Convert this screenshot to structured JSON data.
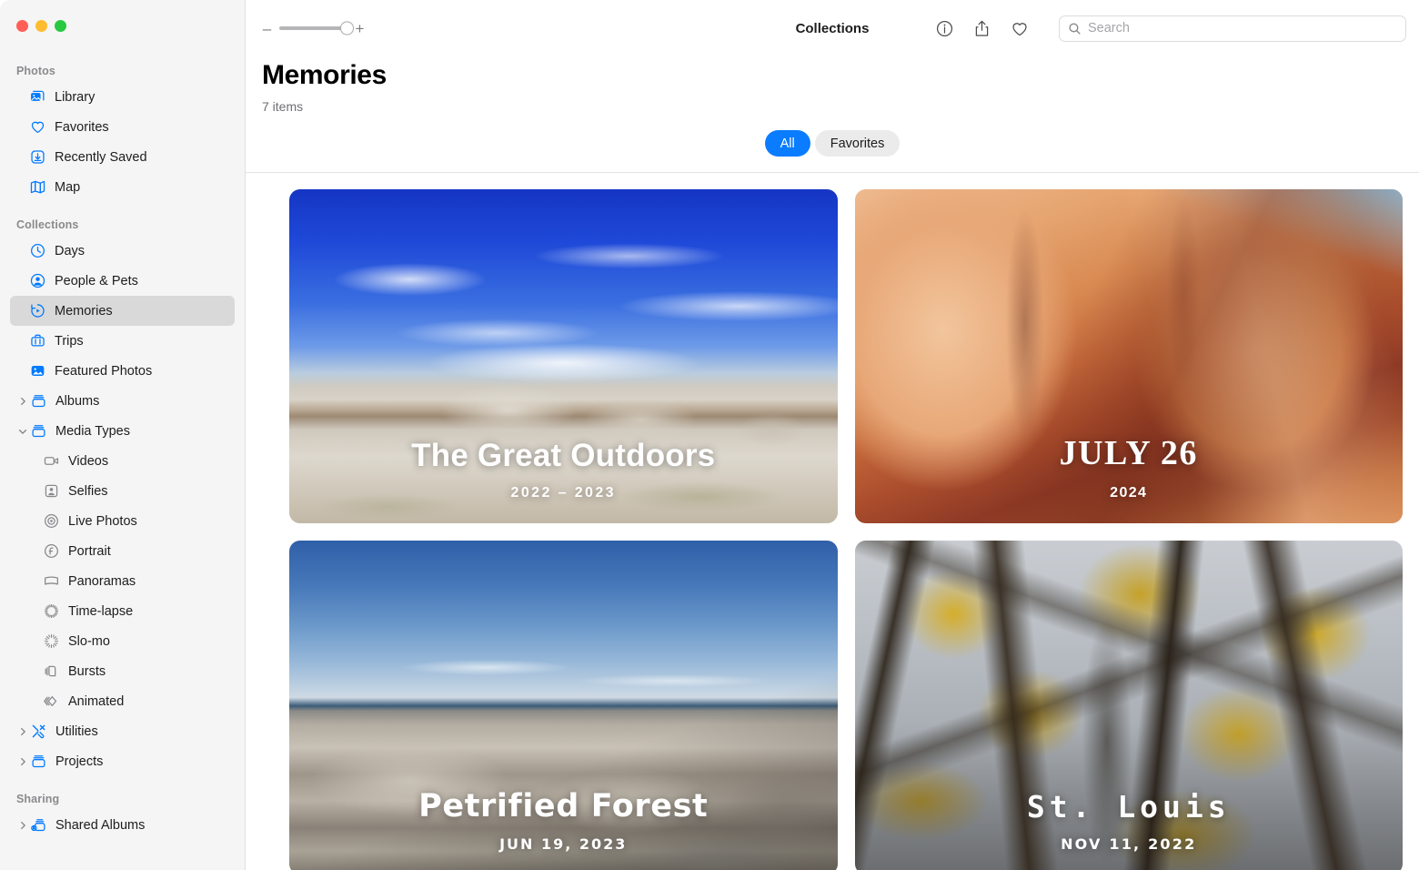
{
  "window": {
    "traffic_lights": [
      {
        "name": "close",
        "color": "#ff5f57"
      },
      {
        "name": "minimize",
        "color": "#febc2e"
      },
      {
        "name": "zoom",
        "color": "#28c840"
      }
    ]
  },
  "toolbar": {
    "zoom_out_label": "–",
    "zoom_in_label": "+",
    "zoom_value": 85,
    "title": "Collections",
    "icons": [
      {
        "name": "info-icon",
        "label": "Info"
      },
      {
        "name": "share-icon",
        "label": "Share"
      },
      {
        "name": "favorite-heart-icon",
        "label": "Favorite"
      }
    ],
    "search": {
      "placeholder": "Search",
      "value": "",
      "icon": "search-icon"
    }
  },
  "sidebar": {
    "sections": [
      {
        "title": "Photos",
        "items": [
          {
            "label": "Library",
            "icon": "library-icon",
            "icon_style": "blue",
            "disclosure": "none",
            "indent": 0,
            "selected": false
          },
          {
            "label": "Favorites",
            "icon": "heart-icon",
            "icon_style": "blue",
            "disclosure": "none",
            "indent": 0,
            "selected": false
          },
          {
            "label": "Recently Saved",
            "icon": "download-icon",
            "icon_style": "blue",
            "disclosure": "none",
            "indent": 0,
            "selected": false
          },
          {
            "label": "Map",
            "icon": "map-icon",
            "icon_style": "blue",
            "disclosure": "none",
            "indent": 0,
            "selected": false
          }
        ]
      },
      {
        "title": "Collections",
        "items": [
          {
            "label": "Days",
            "icon": "clock-icon",
            "icon_style": "blue",
            "disclosure": "none",
            "indent": 0,
            "selected": false
          },
          {
            "label": "People & Pets",
            "icon": "person-circle-icon",
            "icon_style": "blue",
            "disclosure": "none",
            "indent": 0,
            "selected": false
          },
          {
            "label": "Memories",
            "icon": "memories-icon",
            "icon_style": "blue",
            "disclosure": "none",
            "indent": 0,
            "selected": true
          },
          {
            "label": "Trips",
            "icon": "suitcase-icon",
            "icon_style": "blue",
            "disclosure": "none",
            "indent": 0,
            "selected": false
          },
          {
            "label": "Featured Photos",
            "icon": "featured-photo-icon",
            "icon_style": "blue-filled",
            "disclosure": "none",
            "indent": 0,
            "selected": false
          },
          {
            "label": "Albums",
            "icon": "album-icon",
            "icon_style": "blue",
            "disclosure": "collapsed",
            "indent": 0,
            "selected": false
          },
          {
            "label": "Media Types",
            "icon": "album-icon",
            "icon_style": "blue",
            "disclosure": "expanded",
            "indent": 0,
            "selected": false
          },
          {
            "label": "Videos",
            "icon": "video-icon",
            "icon_style": "gray",
            "disclosure": "none",
            "indent": 1,
            "selected": false
          },
          {
            "label": "Selfies",
            "icon": "selfie-icon",
            "icon_style": "gray",
            "disclosure": "none",
            "indent": 1,
            "selected": false
          },
          {
            "label": "Live Photos",
            "icon": "live-photo-icon",
            "icon_style": "gray",
            "disclosure": "none",
            "indent": 1,
            "selected": false
          },
          {
            "label": "Portrait",
            "icon": "portrait-icon",
            "icon_style": "gray",
            "disclosure": "none",
            "indent": 1,
            "selected": false
          },
          {
            "label": "Panoramas",
            "icon": "panorama-icon",
            "icon_style": "gray",
            "disclosure": "none",
            "indent": 1,
            "selected": false
          },
          {
            "label": "Time-lapse",
            "icon": "timelapse-icon",
            "icon_style": "gray",
            "disclosure": "none",
            "indent": 1,
            "selected": false
          },
          {
            "label": "Slo-mo",
            "icon": "slomo-icon",
            "icon_style": "gray",
            "disclosure": "none",
            "indent": 1,
            "selected": false
          },
          {
            "label": "Bursts",
            "icon": "bursts-icon",
            "icon_style": "gray",
            "disclosure": "none",
            "indent": 1,
            "selected": false
          },
          {
            "label": "Animated",
            "icon": "animated-icon",
            "icon_style": "gray",
            "disclosure": "none",
            "indent": 1,
            "selected": false
          },
          {
            "label": "Utilities",
            "icon": "utilities-icon",
            "icon_style": "blue",
            "disclosure": "collapsed",
            "indent": 0,
            "selected": false
          },
          {
            "label": "Projects",
            "icon": "album-icon",
            "icon_style": "blue",
            "disclosure": "collapsed",
            "indent": 0,
            "selected": false
          }
        ]
      },
      {
        "title": "Sharing",
        "items": [
          {
            "label": "Shared Albums",
            "icon": "shared-album-icon",
            "icon_style": "blue",
            "disclosure": "collapsed",
            "indent": 0,
            "selected": false
          }
        ]
      }
    ]
  },
  "header": {
    "title": "Memories",
    "subtitle": "7 items"
  },
  "filters": {
    "options": [
      {
        "label": "All",
        "selected": true
      },
      {
        "label": "Favorites",
        "selected": false
      }
    ],
    "accent_color": "#0a7cff"
  },
  "memories": [
    {
      "title": "The Great Outdoors",
      "subtitle": "2022 – 2023",
      "art": "art-desert1",
      "font": "f-geo"
    },
    {
      "title": "JULY 26",
      "subtitle": "2024",
      "art": "art-canyon",
      "font": "f-serif"
    },
    {
      "title": "Petrified Forest",
      "subtitle": "JUN 19, 2023",
      "art": "art-badlands",
      "font": "f-rounded"
    },
    {
      "title": "St. Louis",
      "subtitle": "NOV 11, 2022",
      "art": "art-trees",
      "font": "f-mono"
    }
  ]
}
